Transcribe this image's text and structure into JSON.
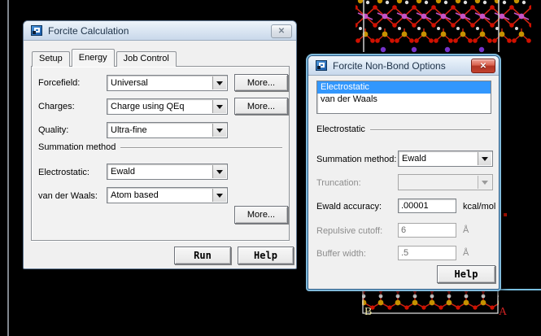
{
  "left_dialog": {
    "title": "Forcite Calculation",
    "tabs": [
      {
        "label": "Setup"
      },
      {
        "label": "Energy"
      },
      {
        "label": "Job Control"
      }
    ],
    "fields": {
      "forcefield": {
        "label": "Forcefield:",
        "value": "Universal",
        "more_label": "More..."
      },
      "charges": {
        "label": "Charges:",
        "value": "Charge using QEq",
        "more_label": "More..."
      },
      "quality": {
        "label": "Quality:",
        "value": "Ultra-fine"
      },
      "summation_group_label": "Summation method",
      "electrostatic": {
        "label": "Electrostatic:",
        "value": "Ewald"
      },
      "vdw": {
        "label": "van der Waals:",
        "value": "Atom based"
      },
      "more_label": "More..."
    },
    "buttons": {
      "run": "Run",
      "help": "Help"
    }
  },
  "right_dialog": {
    "title": "Forcite Non-Bond Options",
    "list": {
      "items": [
        {
          "label": "Electrostatic",
          "selected": true
        },
        {
          "label": "van der Waals",
          "selected": false
        }
      ]
    },
    "group_label": "Electrostatic",
    "fields": {
      "summation": {
        "label": "Summation method:",
        "value": "Ewald"
      },
      "truncation": {
        "label": "Truncation:",
        "value": ""
      },
      "ewald_accuracy": {
        "label": "Ewald accuracy:",
        "value": ".00001",
        "unit": "kcal/mol"
      },
      "repulsive_cutoff": {
        "label": "Repulsive cutoff:",
        "value": "6",
        "unit": "Å"
      },
      "buffer_width": {
        "label": "Buffer width:",
        "value": ".5",
        "unit": "Å"
      }
    },
    "help_label": "Help"
  },
  "background": {
    "cell_labels": {
      "a": "A",
      "b": "B"
    },
    "colors": {
      "oxygen": "#d01000",
      "silicon": "#c79200",
      "hydrogen": "#dcdcdc",
      "metal": "#c653c6",
      "ion": "#7733cc",
      "cell_line": "#cfcfcf",
      "label_a": "#cc2222",
      "label_b": "#e8e2a2",
      "selection": "#3297fd",
      "close_button": "#b03524"
    }
  }
}
